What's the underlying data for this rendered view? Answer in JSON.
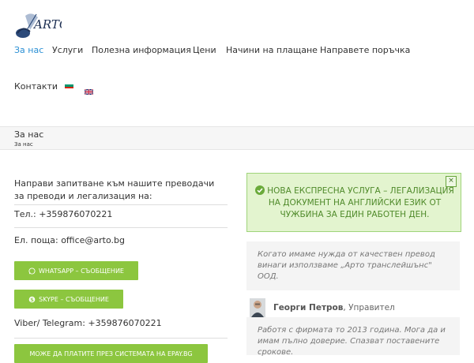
{
  "logo": {
    "text": "ARTO"
  },
  "nav": {
    "items": [
      {
        "label": "За нас"
      },
      {
        "label": "Услуги"
      },
      {
        "label": "Полезна информация"
      },
      {
        "label": "Цени"
      },
      {
        "label": "Начини на плащане"
      },
      {
        "label": "Направете поръчка"
      },
      {
        "label": "Контакти"
      }
    ],
    "flags": [
      "bg-flag-icon",
      "uk-flag-icon"
    ]
  },
  "page_title": {
    "title": "За нас",
    "breadcrumb": "За нас"
  },
  "contact": {
    "intro": "Направи запитване към нашите преводачи за преводи и легализация на:",
    "phone_label": "Тел.: ",
    "phone": "+359876070221",
    "email_label": "Ел. поща: ",
    "email": "office@arto.bg",
    "whatsapp_button": "WHATSAPP – СЪОБЩЕНИЕ",
    "skype_button": "SKYPE – СЪОБЩЕНИЕ",
    "viber": "Viber/ Telegram: +359876070221",
    "epay_button": "МОЖЕ ДА ПЛАТИТЕ ПРЕЗ СИСТЕМАТА НА EPAY.BG"
  },
  "alert": {
    "text": "НОВА ЕКСПРЕСНА УСЛУГА – ЛЕГАЛИЗАЦИЯ НА ДОКУМЕНТ НА АНГЛИЙСКИ ЕЗИК ОТ ЧУЖБИНА ЗА ЕДИН РАБОТЕН ДЕН.",
    "close": "×"
  },
  "testimonials": {
    "quote1": "Когато имаме нужда от качествен превод винаги използваме „Арто транслейшънс\" ООД.",
    "author_name": "Георги Петров",
    "author_role": ", Управител",
    "quote2": "Работя с фирмата то 2013 година. Мога да и имам пълно доверие. Спазват поставените срокове."
  },
  "colors": {
    "accent": "#2a8fd4",
    "button_green": "#8cc63f",
    "alert_bg": "#e3f4cf",
    "alert_text": "#4f8a2a"
  }
}
